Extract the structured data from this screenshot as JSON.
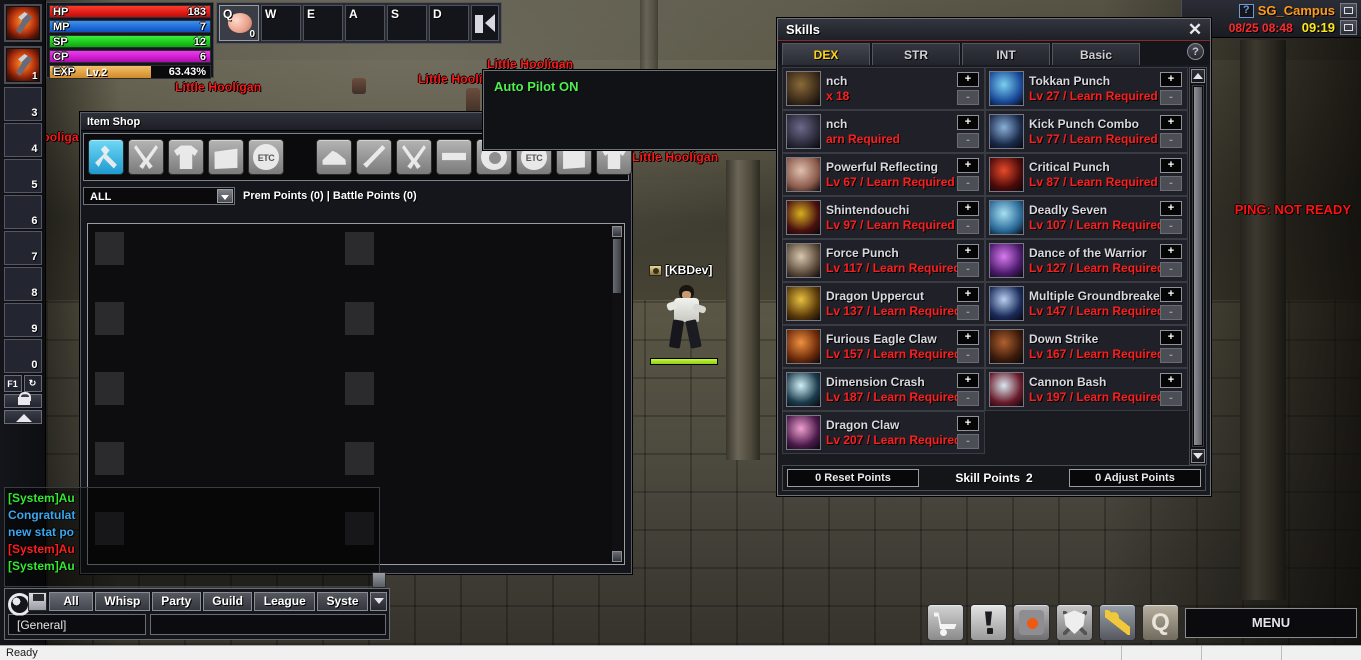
{
  "status_bars": [
    {
      "label": "HP",
      "value": "183",
      "color": "#e01010",
      "pct": 100
    },
    {
      "label": "MP",
      "value": "7",
      "color": "#1a6fe0",
      "pct": 100
    },
    {
      "label": "SP",
      "value": "12",
      "color": "#18c018",
      "pct": 100
    },
    {
      "label": "CP",
      "value": "6",
      "color": "#d818d8",
      "pct": 100
    },
    {
      "label": "EXP",
      "value": "63.43%",
      "level": "Lv.2",
      "color": "#e8a83c",
      "pct": 63.43
    }
  ],
  "hotbar": {
    "slots": [
      {
        "key": "Q",
        "count": "0",
        "has_item": true
      },
      {
        "key": "W",
        "count": "",
        "has_item": false
      },
      {
        "key": "E",
        "count": "",
        "has_item": false
      },
      {
        "key": "A",
        "count": "",
        "has_item": false
      },
      {
        "key": "S",
        "count": "",
        "has_item": false
      },
      {
        "key": "D",
        "count": "",
        "has_item": false
      }
    ]
  },
  "left_bar": {
    "slots": [
      "3",
      "4",
      "5",
      "6",
      "7",
      "8",
      "9",
      "0"
    ],
    "f1_label": "F1"
  },
  "topright": {
    "help_label": "?",
    "server": "SG_Campus",
    "date": "08/25 08:48",
    "time": "09:19"
  },
  "ping_text": "PING: NOT READY",
  "world": {
    "player_name": "[KBDev]",
    "mob_names": [
      "Little Hooligan",
      "Little Hooligan",
      "Little Hooligan",
      "Little Hooligan",
      "Little Hooligan",
      "Little Hooligan"
    ],
    "autopilot_text": "Auto Pilot ON"
  },
  "item_shop": {
    "title": "Item Shop",
    "category_icons": [
      "tools-icon",
      "scissors-icon",
      "cloth-icon",
      "gift-icon",
      "etc-bag-icon",
      "shoe-icon",
      "sword-icon",
      "scissors-icon",
      "belt-icon",
      "ring-icon",
      "etc-bag-icon",
      "box-icon",
      "cloth-icon"
    ],
    "filter_value": "ALL",
    "points_text": "Prem Points (0) | Battle Points (0)"
  },
  "skills": {
    "title": "Skills",
    "close_label": "✕",
    "help_label": "?",
    "tabs": [
      {
        "label": "DEX",
        "active": true
      },
      {
        "label": "STR",
        "active": false
      },
      {
        "label": "INT",
        "active": false
      },
      {
        "label": "Basic",
        "active": false
      }
    ],
    "plus_label": "+",
    "minus_label": "-",
    "entries": [
      {
        "name": "nch",
        "req": "x 18",
        "icon_colors": [
          "#3a2a18",
          "#8a6a3a"
        ],
        "obscured": true
      },
      {
        "name": "Tokkan Punch",
        "req": "Lv 27 / Learn Required",
        "icon_colors": [
          "#1a4a9a",
          "#7ad0f0"
        ]
      },
      {
        "name": "nch",
        "req": "arn Required",
        "icon_colors": [
          "#2a2a3a",
          "#6a6a8a"
        ],
        "obscured": true
      },
      {
        "name": "Kick Punch Combo",
        "req": "Lv 77 / Learn Required",
        "icon_colors": [
          "#1a2a4a",
          "#8ab0d8"
        ]
      },
      {
        "name": "Powerful Reflecting",
        "req": "Lv 67 / Learn Required",
        "icon_colors": [
          "#8a5a4a",
          "#e0c0b0"
        ]
      },
      {
        "name": "Critical Punch",
        "req": "Lv 87 / Learn Required",
        "icon_colors": [
          "#4a0a0a",
          "#e84a2a"
        ]
      },
      {
        "name": "Shintendouchi",
        "req": "Lv 97 / Learn Required",
        "icon_colors": [
          "#4a1010",
          "#d8b020"
        ]
      },
      {
        "name": "Deadly Seven",
        "req": "Lv 107 / Learn Required",
        "icon_colors": [
          "#2a6a9a",
          "#a8e0f0"
        ]
      },
      {
        "name": "Force Punch",
        "req": "Lv 117 / Learn Required",
        "icon_colors": [
          "#5a4a3a",
          "#d8c8b0"
        ]
      },
      {
        "name": "Dance of the Warrior",
        "req": "Lv 127 / Learn Required",
        "icon_colors": [
          "#4a1a6a",
          "#d87af0"
        ]
      },
      {
        "name": "Dragon Uppercut",
        "req": "Lv 137 / Learn Required",
        "icon_colors": [
          "#5a3a0a",
          "#e8c040"
        ]
      },
      {
        "name": "Multiple Groundbreaker",
        "req": "Lv 147 / Learn Required",
        "icon_colors": [
          "#1a2a5a",
          "#b8d0f0"
        ]
      },
      {
        "name": "Furious Eagle Claw",
        "req": "Lv 157 / Learn Required",
        "icon_colors": [
          "#6a2a0a",
          "#f09040"
        ]
      },
      {
        "name": "Down Strike",
        "req": "Lv 167 / Learn Required",
        "icon_colors": [
          "#3a1a0a",
          "#b06030"
        ]
      },
      {
        "name": "Dimension Crash",
        "req": "Lv 187 / Learn Required",
        "icon_colors": [
          "#1a3a4a",
          "#d0f0f8"
        ]
      },
      {
        "name": "Cannon Bash",
        "req": "Lv 197 / Learn Required",
        "icon_colors": [
          "#6a1a2a",
          "#d8e8f0"
        ]
      },
      {
        "name": "Dragon Claw",
        "req": "Lv 207 / Learn Required",
        "icon_colors": [
          "#4a1a4a",
          "#f0a0d0"
        ]
      }
    ],
    "footer": {
      "reset_label": "0 Reset Points",
      "skill_points_label": "Skill Points",
      "skill_points_value": "2",
      "adjust_label": "0 Adjust Points"
    }
  },
  "chat": {
    "messages": [
      {
        "text": "[System]Au",
        "color": "#34e834"
      },
      {
        "text": "Congratulat",
        "color": "#3aa8f0"
      },
      {
        "text": " new stat po",
        "color": "#3aa8f0"
      },
      {
        "text": "[System]Au",
        "color": "#ff1e1e"
      },
      {
        "text": "[System]Au",
        "color": "#34e834"
      }
    ],
    "tabs": [
      {
        "label": "All",
        "active": true
      },
      {
        "label": "Whisp",
        "active": false
      },
      {
        "label": "Party",
        "active": false
      },
      {
        "label": "Guild",
        "active": false
      },
      {
        "label": "League",
        "active": false
      },
      {
        "label": "Syste",
        "active": false
      }
    ],
    "channel_value": "[General]",
    "input_value": ""
  },
  "menu": {
    "icons": [
      "cart-icon",
      "quest-icon",
      "record-icon",
      "shield-icon",
      "skills-icon",
      "q-icon"
    ],
    "q_glyph": "Q",
    "menu_label": "MENU"
  },
  "statusbar": {
    "ready": "Ready"
  }
}
